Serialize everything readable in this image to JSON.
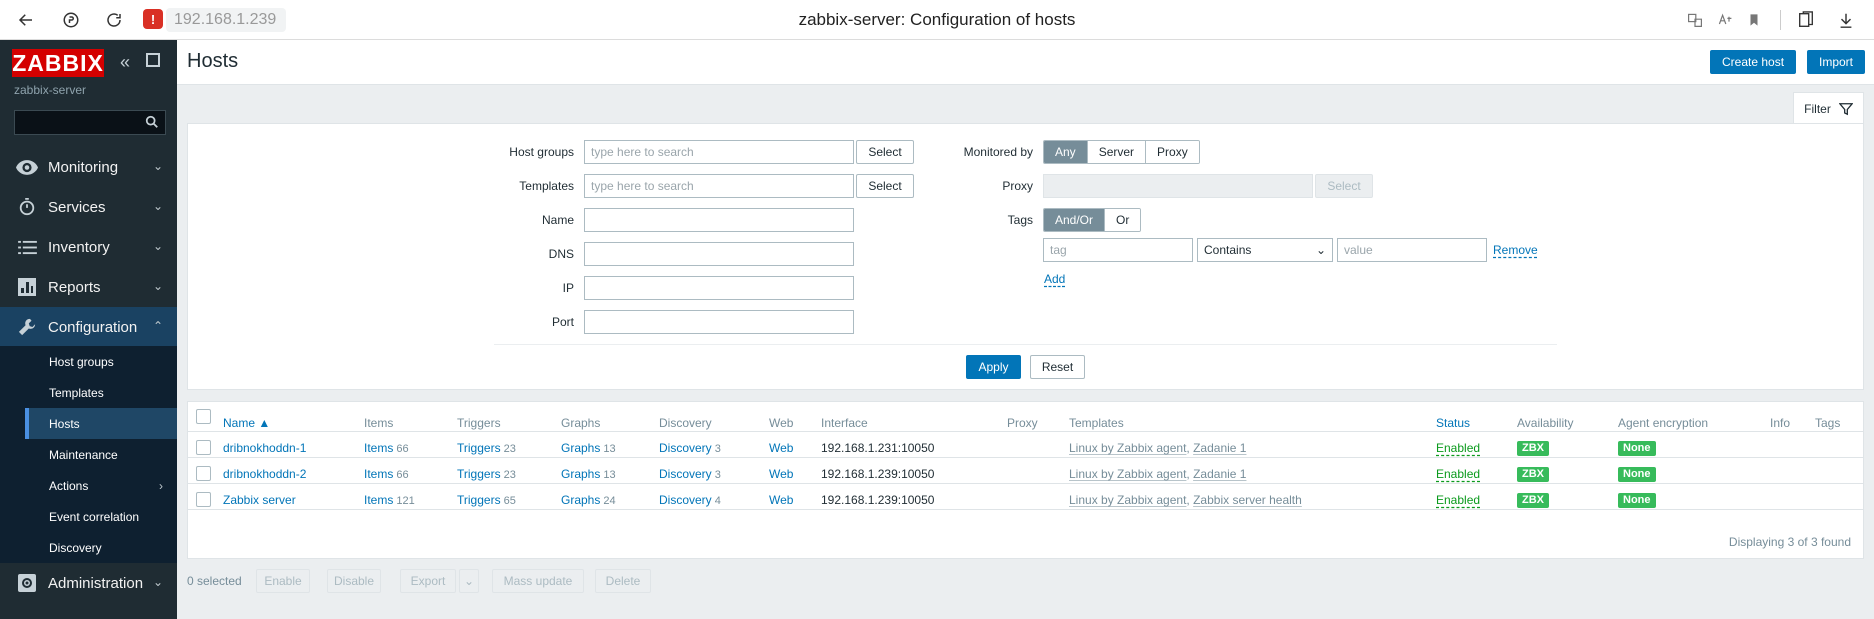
{
  "browser": {
    "url": "192.168.1.239",
    "title": "zabbix-server: Configuration of hosts",
    "warn_icon": "warning-icon"
  },
  "sidebar": {
    "logo": "ZABBIX",
    "server_name": "zabbix-server",
    "search_placeholder": "",
    "menu": [
      {
        "label": "Monitoring",
        "icon": "eye-icon"
      },
      {
        "label": "Services",
        "icon": "stopwatch-icon"
      },
      {
        "label": "Inventory",
        "icon": "list-icon"
      },
      {
        "label": "Reports",
        "icon": "bar-chart-icon"
      },
      {
        "label": "Configuration",
        "icon": "wrench-icon"
      },
      {
        "label": "Administration",
        "icon": "gear-icon"
      }
    ],
    "submenu": [
      "Host groups",
      "Templates",
      "Hosts",
      "Maintenance",
      "Actions",
      "Event correlation",
      "Discovery"
    ]
  },
  "header": {
    "title": "Hosts",
    "create_host": "Create host",
    "import": "Import"
  },
  "filter": {
    "tab_label": "Filter",
    "host_groups_label": "Host groups",
    "host_groups_placeholder": "type here to search",
    "templates_label": "Templates",
    "templates_placeholder": "type here to search",
    "select": "Select",
    "name_label": "Name",
    "dns_label": "DNS",
    "ip_label": "IP",
    "port_label": "Port",
    "monitored_by_label": "Monitored by",
    "monitored_by_options": [
      "Any",
      "Server",
      "Proxy"
    ],
    "monitored_by_selected": "Any",
    "proxy_label": "Proxy",
    "tags_label": "Tags",
    "tags_options": [
      "And/Or",
      "Or"
    ],
    "tag_placeholder": "tag",
    "tag_operator": "Contains",
    "value_placeholder": "value",
    "remove": "Remove",
    "add": "Add",
    "apply": "Apply",
    "reset": "Reset"
  },
  "table": {
    "columns": [
      "Name ▲",
      "Items",
      "Triggers",
      "Graphs",
      "Discovery",
      "Web",
      "Interface",
      "Proxy",
      "Templates",
      "Status",
      "Availability",
      "Agent encryption",
      "Info",
      "Tags"
    ],
    "rows": [
      {
        "name": "dribnokhoddn-1",
        "items": "66",
        "triggers": "23",
        "graphs": "13",
        "discovery": "3",
        "interface": "192.168.1.231:10050",
        "templates": [
          "Linux by Zabbix agent",
          "Zadanie 1"
        ],
        "status": "Enabled",
        "availability": "ZBX",
        "encryption": "None"
      },
      {
        "name": "dribnokhoddn-2",
        "items": "66",
        "triggers": "23",
        "graphs": "13",
        "discovery": "3",
        "interface": "192.168.1.239:10050",
        "templates": [
          "Linux by Zabbix agent",
          "Zadanie 1"
        ],
        "status": "Enabled",
        "availability": "ZBX",
        "encryption": "None"
      },
      {
        "name": "Zabbix server",
        "items": "121",
        "triggers": "65",
        "graphs": "24",
        "discovery": "4",
        "interface": "192.168.1.239:10050",
        "templates": [
          "Linux by Zabbix agent",
          "Zabbix server health"
        ],
        "status": "Enabled",
        "availability": "ZBX",
        "encryption": "None"
      }
    ],
    "link_labels": {
      "items": "Items",
      "triggers": "Triggers",
      "graphs": "Graphs",
      "discovery": "Discovery",
      "web": "Web"
    },
    "footer": "Displaying 3 of 3 found"
  },
  "bottom": {
    "selected": "0 selected",
    "enable": "Enable",
    "disable": "Disable",
    "export": "Export",
    "mass_update": "Mass update",
    "delete": "Delete"
  },
  "colors": {
    "accent": "#0275b8",
    "sidebar": "#1f2c33",
    "logo": "#d40000",
    "enabled": "#0b9a1d",
    "badge": "#37bb5b"
  }
}
